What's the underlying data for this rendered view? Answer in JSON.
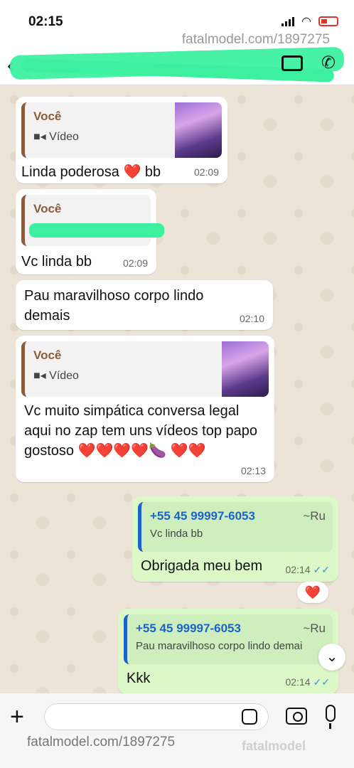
{
  "status_bar": {
    "time": "02:15",
    "watermark": "fatalmodel.com/1897275"
  },
  "header": {},
  "messages": [
    {
      "quote_author": "Você",
      "quote_sub": "Vídeo",
      "text": "Linda poderosa ❤️ bb",
      "time": "02:09"
    },
    {
      "quote_author": "Você",
      "text": "Vc linda bb",
      "time": "02:09"
    },
    {
      "text": "Pau maravilhoso corpo lindo demais",
      "time": "02:10"
    },
    {
      "quote_author": "Você",
      "quote_sub": "Vídeo",
      "text": "Vc muito simpática conversa  legal aqui no zap   tem uns vídeos top papo gostoso        ❤️❤️❤️❤️🍆 ❤️❤️",
      "time": "02:13"
    },
    {
      "quote_author": "+55 45 99997-6053",
      "quote_tag": "~Ru",
      "quote_sub": "Vc linda bb",
      "text": "Obrigada meu bem",
      "time": "02:14",
      "ticks": "✓✓"
    },
    {
      "quote_author": "+55 45 99997-6053",
      "quote_tag": "~Ru",
      "quote_sub": "Pau maravilhoso corpo lindo demai",
      "text": "Kkk",
      "time": "02:14",
      "ticks": "✓✓"
    }
  ],
  "reaction": "❤️",
  "input": {
    "value": ""
  },
  "footer": {
    "watermark": "fatalmodel.com/1897275",
    "brand": "fatalmodel"
  }
}
